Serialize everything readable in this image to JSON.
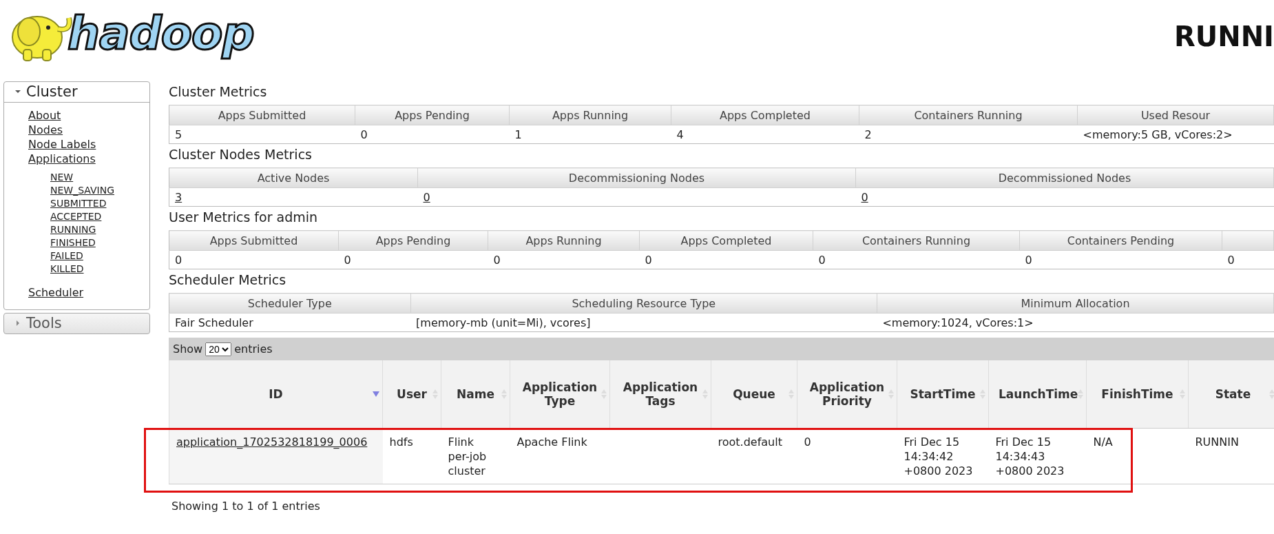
{
  "header": {
    "logo_text": "hadoop",
    "title": "RUNNI"
  },
  "sidebar": [
    {
      "label": "Cluster",
      "expanded": true,
      "items": [
        {
          "label": "About"
        },
        {
          "label": "Nodes"
        },
        {
          "label": "Node Labels"
        },
        {
          "label": "Applications",
          "children": [
            {
              "label": "NEW"
            },
            {
              "label": "NEW_SAVING"
            },
            {
              "label": "SUBMITTED"
            },
            {
              "label": "ACCEPTED"
            },
            {
              "label": "RUNNING"
            },
            {
              "label": "FINISHED"
            },
            {
              "label": "FAILED"
            },
            {
              "label": "KILLED"
            }
          ]
        },
        {
          "label": "Scheduler"
        }
      ]
    },
    {
      "label": "Tools",
      "expanded": false
    }
  ],
  "metrics": [
    {
      "title": "Cluster Metrics",
      "columns": [
        "Apps Submitted",
        "Apps Pending",
        "Apps Running",
        "Apps Completed",
        "Containers Running",
        "Used Resour"
      ],
      "cells": [
        {
          "text": "5",
          "link": false
        },
        {
          "text": "0",
          "link": false
        },
        {
          "text": "1",
          "link": false
        },
        {
          "text": "4",
          "link": false
        },
        {
          "text": "2",
          "link": false
        },
        {
          "text": "<memory:5 GB, vCores:2>",
          "link": false
        }
      ]
    },
    {
      "title": "Cluster Nodes Metrics",
      "columns": [
        "Active Nodes",
        "Decommissioning Nodes",
        "Decommissioned Nodes"
      ],
      "cells": [
        {
          "text": "3",
          "link": true
        },
        {
          "text": "0",
          "link": true
        },
        {
          "text": "0",
          "link": true
        }
      ]
    },
    {
      "title": "User Metrics for admin",
      "columns": [
        "Apps Submitted",
        "Apps Pending",
        "Apps Running",
        "Apps Completed",
        "Containers Running",
        "Containers Pending"
      ],
      "cells": [
        {
          "text": "0",
          "link": false
        },
        {
          "text": "0",
          "link": false
        },
        {
          "text": "0",
          "link": false
        },
        {
          "text": "0",
          "link": false
        },
        {
          "text": "0",
          "link": false
        },
        {
          "text": "0",
          "link": false
        },
        {
          "text": "0",
          "link": false
        }
      ]
    },
    {
      "title": "Scheduler Metrics",
      "columns": [
        "Scheduler Type",
        "Scheduling Resource Type",
        "Minimum Allocation"
      ],
      "cells": [
        {
          "text": "Fair Scheduler",
          "link": false
        },
        {
          "text": "[memory-mb (unit=Mi), vcores]",
          "link": false
        },
        {
          "text": "<memory:1024, vCores:1>",
          "link": false
        }
      ]
    }
  ],
  "apps": {
    "show_label": "Show",
    "page_length": "20",
    "entries_label": "entries",
    "columns": [
      {
        "label": "ID",
        "sorted": true
      },
      {
        "label": "User",
        "sorted": false
      },
      {
        "label": "Name",
        "sorted": false
      },
      {
        "label": "Application Type",
        "sorted": false
      },
      {
        "label": "Application Tags",
        "sorted": false
      },
      {
        "label": "Queue",
        "sorted": false
      },
      {
        "label": "Application Priority",
        "sorted": false
      },
      {
        "label": "StartTime",
        "sorted": false
      },
      {
        "label": "LaunchTime",
        "sorted": false
      },
      {
        "label": "FinishTime",
        "sorted": false
      },
      {
        "label": "State",
        "sorted": false
      }
    ],
    "rows": [
      {
        "highlighted": true,
        "cells": [
          "application_1702532818199_0006",
          "hdfs",
          "Flink per-job cluster",
          "Apache Flink",
          null,
          "root.default",
          "0",
          "Fri Dec 15 14:34:42 +0800 2023",
          "Fri Dec 15 14:34:43 +0800 2023",
          "N/A",
          "RUNNIN"
        ]
      }
    ],
    "info": "Showing 1 to 1 of 1 entries"
  }
}
